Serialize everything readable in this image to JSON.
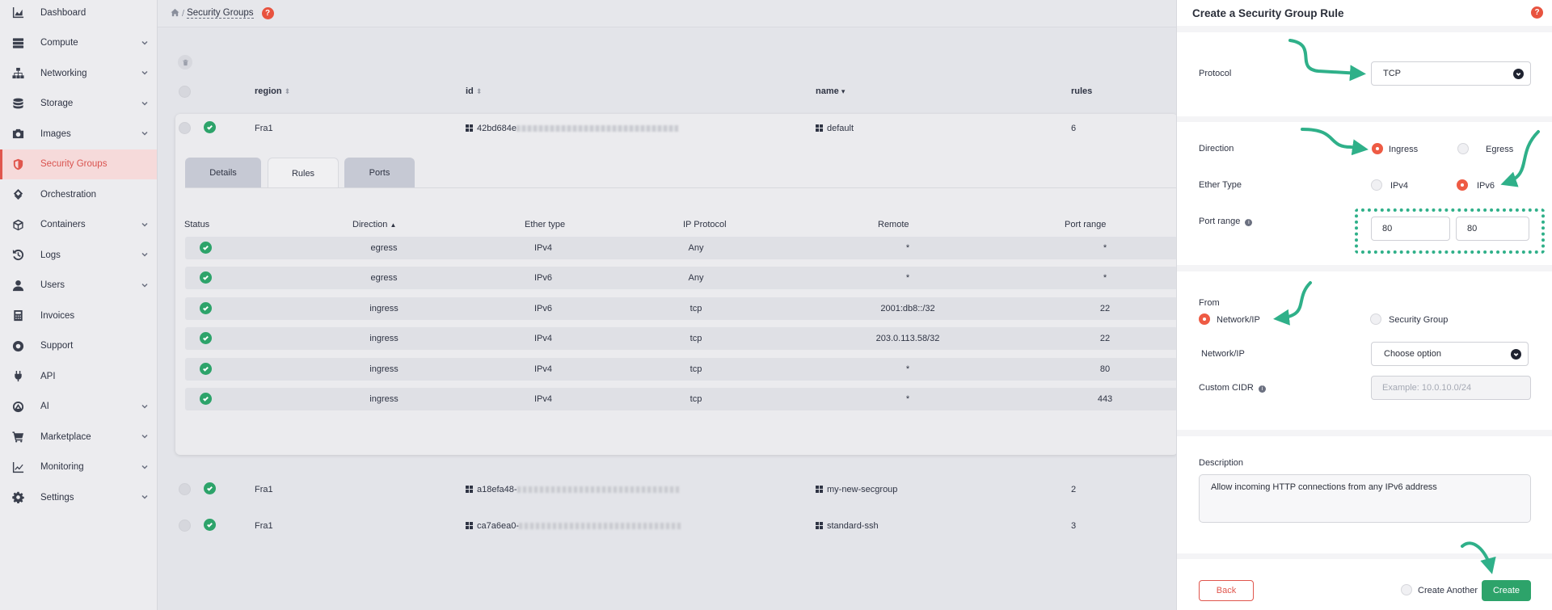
{
  "sidebar": {
    "items": [
      {
        "label": "Dashboard",
        "icon": "chart-area-icon",
        "has_chevron": false
      },
      {
        "label": "Compute",
        "icon": "server-icon",
        "has_chevron": true
      },
      {
        "label": "Networking",
        "icon": "network-icon",
        "has_chevron": true
      },
      {
        "label": "Storage",
        "icon": "database-icon",
        "has_chevron": true
      },
      {
        "label": "Images",
        "icon": "camera-icon",
        "has_chevron": true
      },
      {
        "label": "Security Groups",
        "icon": "shield-icon",
        "has_chevron": false,
        "active": true
      },
      {
        "label": "Orchestration",
        "icon": "orchestration-icon",
        "has_chevron": false
      },
      {
        "label": "Containers",
        "icon": "cube-icon",
        "has_chevron": true
      },
      {
        "label": "Logs",
        "icon": "history-icon",
        "has_chevron": true
      },
      {
        "label": "Users",
        "icon": "user-icon",
        "has_chevron": true
      },
      {
        "label": "Invoices",
        "icon": "calculator-icon",
        "has_chevron": false
      },
      {
        "label": "Support",
        "icon": "lifebuoy-icon",
        "has_chevron": false
      },
      {
        "label": "API",
        "icon": "plug-icon",
        "has_chevron": false
      },
      {
        "label": "AI",
        "icon": "ai-icon",
        "has_chevron": true
      },
      {
        "label": "Marketplace",
        "icon": "cart-icon",
        "has_chevron": true
      },
      {
        "label": "Monitoring",
        "icon": "line-chart-icon",
        "has_chevron": true
      },
      {
        "label": "Settings",
        "icon": "gear-icon",
        "has_chevron": true
      }
    ]
  },
  "breadcrumb": {
    "separator": "/",
    "current": "Security Groups",
    "help": "?"
  },
  "groups_table": {
    "columns": {
      "region": "region",
      "id": "id",
      "name": "name",
      "rules": "rules"
    },
    "rows": [
      {
        "region": "Fra1",
        "id": "42bd684e",
        "name": "default",
        "rules": "6"
      },
      {
        "region": "Fra1",
        "id": "a18efa48-",
        "name": "my-new-secgroup",
        "rules": "2"
      },
      {
        "region": "Fra1",
        "id": "ca7a6ea0-",
        "name": "standard-ssh",
        "rules": "3"
      }
    ]
  },
  "tabs": [
    "Details",
    "Rules",
    "Ports"
  ],
  "rules_table": {
    "columns": [
      "Status",
      "Direction",
      "Ether type",
      "IP Protocol",
      "Remote",
      "Port range"
    ],
    "rows": [
      {
        "direction": "egress",
        "ether": "IPv4",
        "protocol": "Any",
        "remote": "*",
        "port": "*"
      },
      {
        "direction": "egress",
        "ether": "IPv6",
        "protocol": "Any",
        "remote": "*",
        "port": "*"
      },
      {
        "direction": "ingress",
        "ether": "IPv6",
        "protocol": "tcp",
        "remote": "2001:db8::/32",
        "port": "22"
      },
      {
        "direction": "ingress",
        "ether": "IPv4",
        "protocol": "tcp",
        "remote": "203.0.113.58/32",
        "port": "22"
      },
      {
        "direction": "ingress",
        "ether": "IPv4",
        "protocol": "tcp",
        "remote": "*",
        "port": "80"
      },
      {
        "direction": "ingress",
        "ether": "IPv4",
        "protocol": "tcp",
        "remote": "*",
        "port": "443"
      }
    ]
  },
  "drawer": {
    "title": "Create a Security Group Rule",
    "help": "?",
    "protocol_label": "Protocol",
    "protocol_value": "TCP",
    "direction_label": "Direction",
    "direction_options": [
      "Ingress",
      "Egress"
    ],
    "direction_selected": "Ingress",
    "ether_label": "Ether Type",
    "ether_options": [
      "IPv4",
      "IPv6"
    ],
    "ether_selected": "IPv6",
    "port_label": "Port range",
    "port_min": "80",
    "port_max": "80",
    "from_label": "From",
    "from_options": [
      "Network/IP",
      "Security Group"
    ],
    "from_selected": "Network/IP",
    "network_label": "Network/IP",
    "network_value": "Choose option",
    "cidr_label": "Custom CIDR",
    "cidr_placeholder": "Example: 10.0.10.0/24",
    "description_label": "Description",
    "description_value": "Allow incoming HTTP connections from any IPv6 address",
    "back_label": "Back",
    "create_another_label": "Create Another",
    "create_label": "Create"
  },
  "colors": {
    "accent": "#e0564d",
    "success": "#2da36a",
    "annotation": "#2fb089"
  }
}
